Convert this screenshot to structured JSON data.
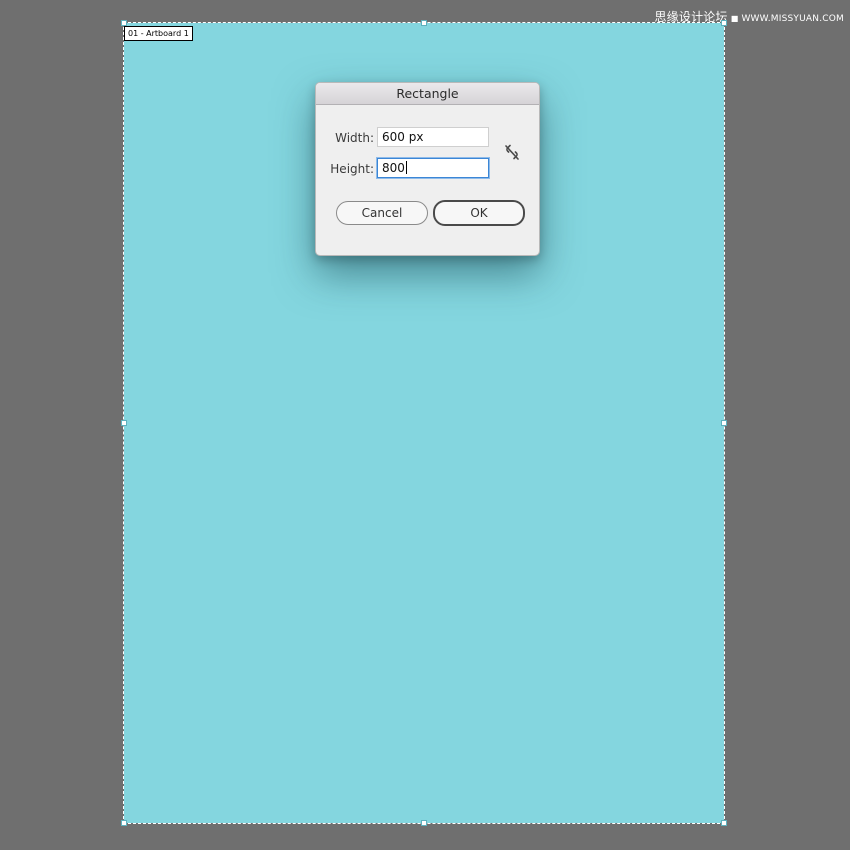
{
  "watermark": {
    "cn": "思缘设计论坛",
    "sep": "■",
    "url": "WWW.MISSYUAN.COM"
  },
  "artboard": {
    "label": "01 - Artboard 1",
    "fill": "#84d6df"
  },
  "dialog": {
    "title": "Rectangle",
    "width_label": "Width:",
    "width_value": "600 px",
    "height_label": "Height:",
    "height_value": "800",
    "constrain_icon": "broken-link-icon",
    "cancel_label": "Cancel",
    "ok_label": "OK"
  },
  "colors": {
    "canvas_bg": "#6f6f6f",
    "focus_ring": "#3b86d6"
  }
}
